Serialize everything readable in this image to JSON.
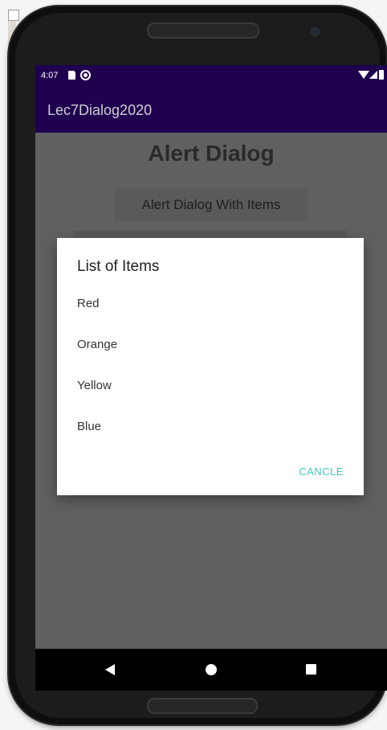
{
  "status_bar": {
    "time": "4:07"
  },
  "app_bar": {
    "title": "Lec7Dialog2020"
  },
  "content": {
    "title": "Alert Dialog",
    "items_button_label": "Alert Dialog With Items"
  },
  "dialog": {
    "title": "List of Items",
    "items": [
      "Red",
      "Orange",
      "Yellow",
      "Blue"
    ],
    "cancel_label": "CANCLE"
  },
  "icons": {
    "status": [
      "sd-card-icon",
      "sync-icon",
      "wifi-icon",
      "signal-icon",
      "battery-icon"
    ],
    "nav": [
      "back-icon",
      "home-icon",
      "recents-icon"
    ]
  },
  "colors": {
    "app_bar": "#1f004f",
    "accent_text": "#3fc9c9",
    "scrim": "#606060"
  }
}
